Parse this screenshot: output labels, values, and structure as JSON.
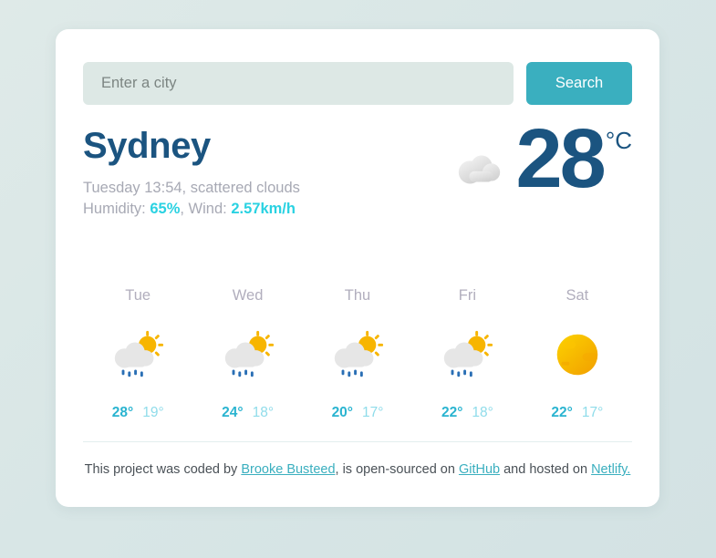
{
  "search": {
    "placeholder": "Enter a city",
    "value": "",
    "button_label": "Search"
  },
  "current": {
    "city": "Sydney",
    "conditions": "Tuesday 13:54, scattered clouds",
    "humidity_prefix": "Humidity: ",
    "humidity_value": "65%",
    "wind_separator": ", Wind: ",
    "wind_value": "2.57km/h",
    "temperature": "28",
    "unit": "°C",
    "icon": "cloud-icon"
  },
  "forecast": [
    {
      "day": "Tue",
      "icon": "rain-sun-cloud-icon",
      "max": "28°",
      "min": "19°"
    },
    {
      "day": "Wed",
      "icon": "rain-sun-cloud-icon",
      "max": "24°",
      "min": "18°"
    },
    {
      "day": "Thu",
      "icon": "rain-sun-cloud-icon",
      "max": "20°",
      "min": "17°"
    },
    {
      "day": "Fri",
      "icon": "rain-sun-cloud-icon",
      "max": "22°",
      "min": "18°"
    },
    {
      "day": "Sat",
      "icon": "sun-icon",
      "max": "22°",
      "min": "17°"
    }
  ],
  "footer": {
    "text_1": "This project was coded by ",
    "link_author": "Brooke Busteed",
    "text_2": ", is open-sourced on ",
    "link_github": "GitHub",
    "text_3": " and hosted on ",
    "link_netlify": "Netlify."
  },
  "colors": {
    "accent_teal": "#3aafbf",
    "accent_cyan": "#2ad2e2",
    "navy": "#1b5480",
    "muted": "#a7a9b4",
    "sun_yellow": "#f7c600",
    "rain_blue": "#2a6fb5"
  }
}
